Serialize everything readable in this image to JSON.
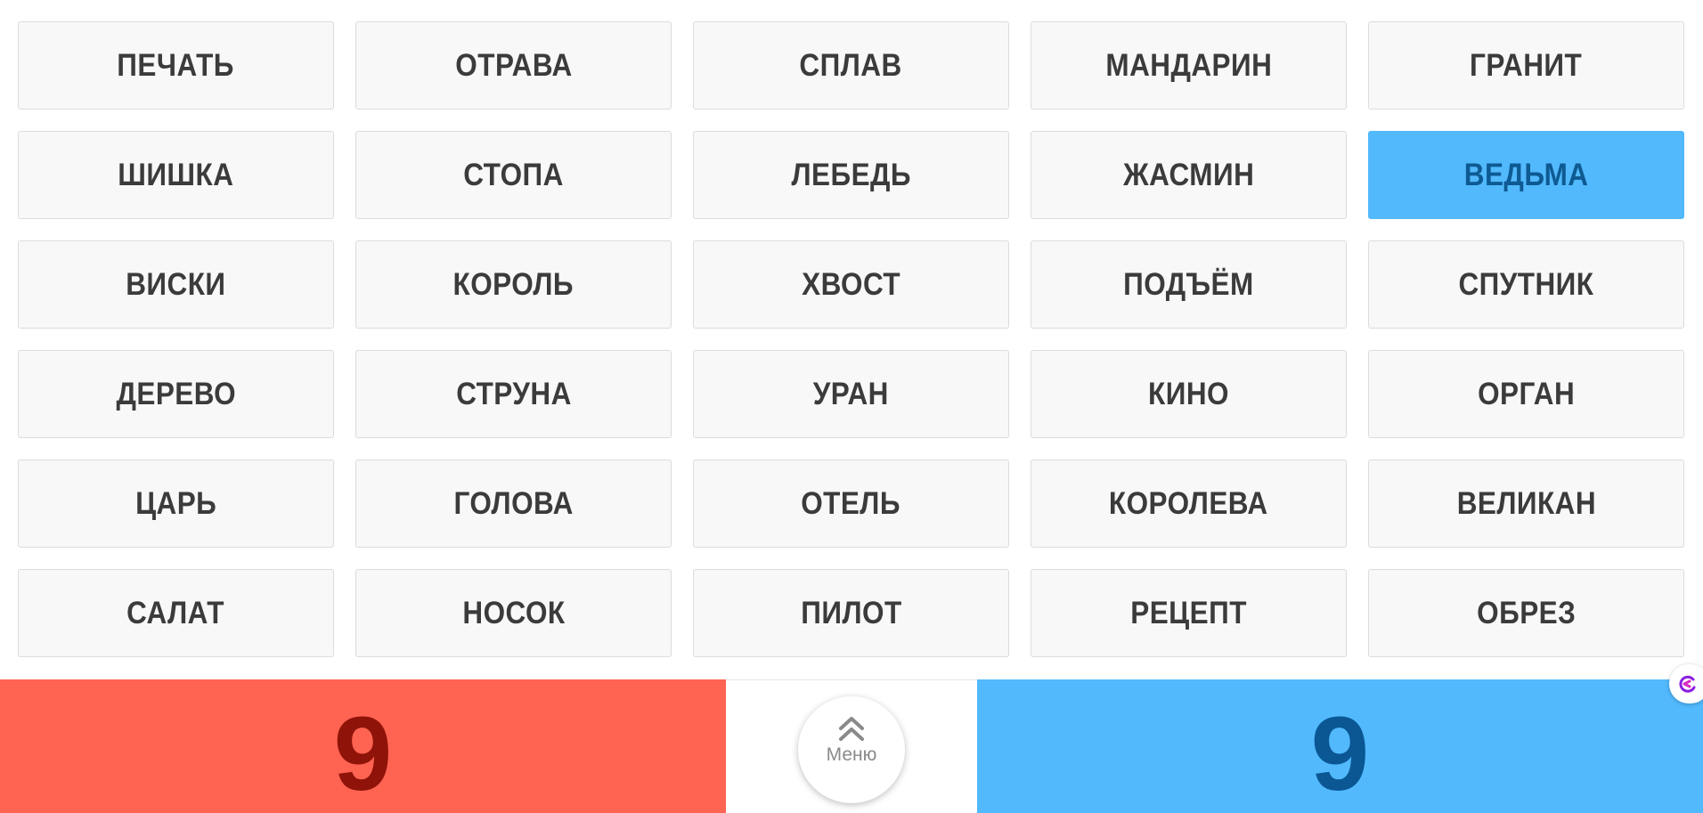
{
  "board": {
    "cards": [
      {
        "word": "ПЕЧАТЬ",
        "state": "neutral"
      },
      {
        "word": "ОТРАВА",
        "state": "neutral"
      },
      {
        "word": "СПЛАВ",
        "state": "neutral"
      },
      {
        "word": "МАНДАРИН",
        "state": "neutral"
      },
      {
        "word": "ГРАНИТ",
        "state": "neutral"
      },
      {
        "word": "ШИШКА",
        "state": "neutral"
      },
      {
        "word": "СТОПА",
        "state": "neutral"
      },
      {
        "word": "ЛЕБЕДЬ",
        "state": "neutral"
      },
      {
        "word": "ЖАСМИН",
        "state": "neutral"
      },
      {
        "word": "ВЕДЬМА",
        "state": "blue"
      },
      {
        "word": "ВИСКИ",
        "state": "neutral"
      },
      {
        "word": "КОРОЛЬ",
        "state": "neutral"
      },
      {
        "word": "ХВОСТ",
        "state": "neutral"
      },
      {
        "word": "ПОДЪЁМ",
        "state": "neutral"
      },
      {
        "word": "СПУТНИК",
        "state": "neutral"
      },
      {
        "word": "ДЕРЕВО",
        "state": "neutral"
      },
      {
        "word": "СТРУНА",
        "state": "neutral"
      },
      {
        "word": "УРАН",
        "state": "neutral"
      },
      {
        "word": "КИНО",
        "state": "neutral"
      },
      {
        "word": "ОРГАН",
        "state": "neutral"
      },
      {
        "word": "ЦАРЬ",
        "state": "neutral"
      },
      {
        "word": "ГОЛОВА",
        "state": "neutral"
      },
      {
        "word": "ОТЕЛЬ",
        "state": "neutral"
      },
      {
        "word": "КОРОЛЕВА",
        "state": "neutral"
      },
      {
        "word": "ВЕЛИКАН",
        "state": "neutral"
      },
      {
        "word": "САЛАТ",
        "state": "neutral"
      },
      {
        "word": "НОСОК",
        "state": "neutral"
      },
      {
        "word": "ПИЛОТ",
        "state": "neutral"
      },
      {
        "word": "РЕЦЕПТ",
        "state": "neutral"
      },
      {
        "word": "ОБРЕЗ",
        "state": "neutral"
      }
    ]
  },
  "scores": {
    "red": "9",
    "blue": "9"
  },
  "menu": {
    "label": "Меню",
    "icon": "double-chevron-up-icon"
  },
  "colors": {
    "red_team": "#ff6352",
    "blue_team": "#52b9fd",
    "card_bg": "#f8f8f8",
    "card_text": "#3b3b3b"
  }
}
